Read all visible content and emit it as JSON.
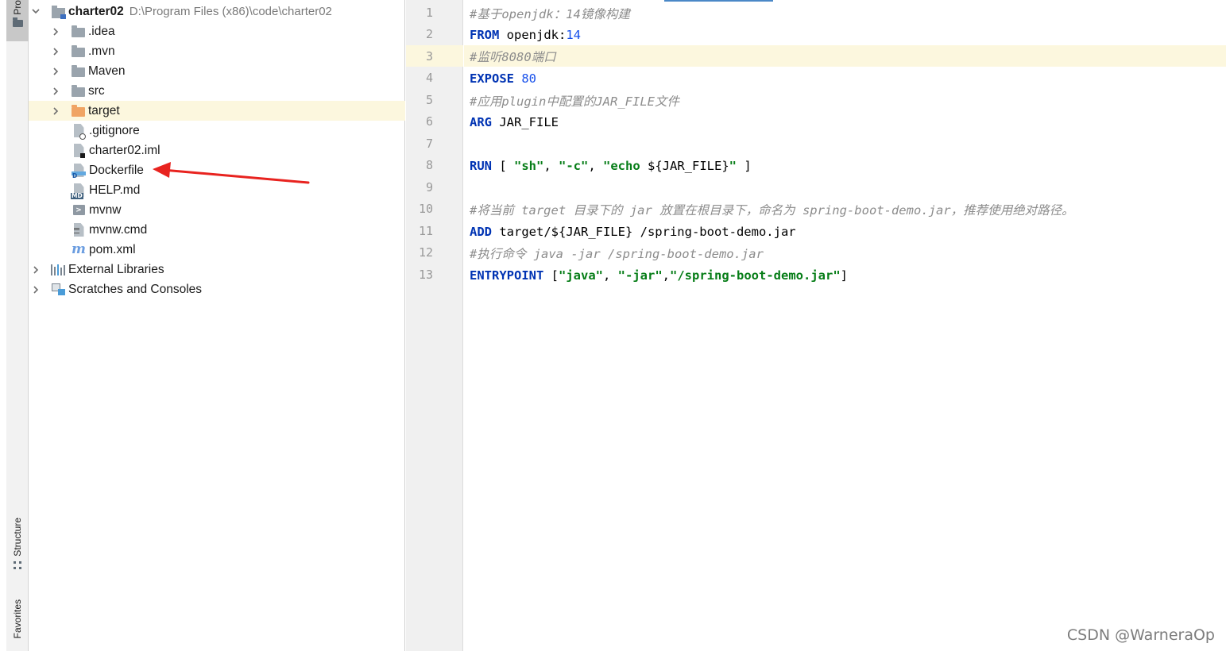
{
  "sidebar": {
    "project_tab": "Pro",
    "structure_tab": "Structure",
    "favorites_tab": "Favorites"
  },
  "project_tree": {
    "root": {
      "name": "charter02",
      "path": "D:\\Program Files (x86)\\code\\charter02"
    },
    "items": [
      {
        "label": ".idea",
        "icon": "folder-icon"
      },
      {
        "label": ".mvn",
        "icon": "folder-icon"
      },
      {
        "label": "Maven",
        "icon": "folder-icon"
      },
      {
        "label": "src",
        "icon": "folder-icon"
      },
      {
        "label": "target",
        "icon": "folder-orange-icon"
      },
      {
        "label": ".gitignore",
        "icon": "gitignore-file-icon"
      },
      {
        "label": "charter02.iml",
        "icon": "iml-file-icon"
      },
      {
        "label": "Dockerfile",
        "icon": "dockerfile-icon"
      },
      {
        "label": "HELP.md",
        "icon": "markdown-file-icon"
      },
      {
        "label": "mvnw",
        "icon": "shell-script-icon"
      },
      {
        "label": "mvnw.cmd",
        "icon": "text-file-icon"
      },
      {
        "label": "pom.xml",
        "icon": "maven-pom-icon"
      }
    ],
    "external_libraries": "External Libraries",
    "scratches": "Scratches and Consoles",
    "md_badge": "MD",
    "docker_badge": "D",
    "run_badge": ">"
  },
  "editor": {
    "line_numbers": [
      "1",
      "2",
      "3",
      "4",
      "5",
      "6",
      "7",
      "8",
      "9",
      "10",
      "11",
      "12",
      "13"
    ],
    "current_line": 3,
    "lines": [
      {
        "comment": "#基于openjdk：14镜像构建"
      },
      {
        "kw": "FROM",
        "rest": " openjdk:",
        "num": "14"
      },
      {
        "comment": "#监听8080端口"
      },
      {
        "kw": "EXPOSE",
        "rest": " ",
        "num": "80"
      },
      {
        "comment": "#应用plugin中配置的JAR_FILE文件"
      },
      {
        "kw": "ARG",
        "rest": " JAR_FILE"
      },
      {},
      {
        "kw": "RUN",
        "p1": " [ ",
        "s1": "\"sh\"",
        "p2": ", ",
        "s2": "\"-c\"",
        "p3": ", ",
        "s3": "\"echo ",
        "p4": "${JAR_FILE}",
        "s4": "\"",
        "p5": " ]"
      },
      {},
      {
        "comment": "#将当前 target 目录下的 jar 放置在根目录下，命名为 spring-boot-demo.jar，推荐使用绝对路径。"
      },
      {
        "kw": "ADD",
        "rest": " target/${JAR_FILE} /spring-boot-demo.jar"
      },
      {
        "comment": "#执行命令 java -jar /spring-boot-demo.jar"
      },
      {
        "kw": "ENTRYPOINT",
        "p1": " [",
        "s1": "\"java\"",
        "p2": ", ",
        "s2": "\"-jar\"",
        "p3": ",",
        "s3": "\"/spring-boot-demo.jar\"",
        "p4": "]"
      }
    ]
  },
  "annotation": {
    "arrow_color": "#e8231f",
    "target": "Dockerfile"
  },
  "watermark": "CSDN @WarneraOp"
}
